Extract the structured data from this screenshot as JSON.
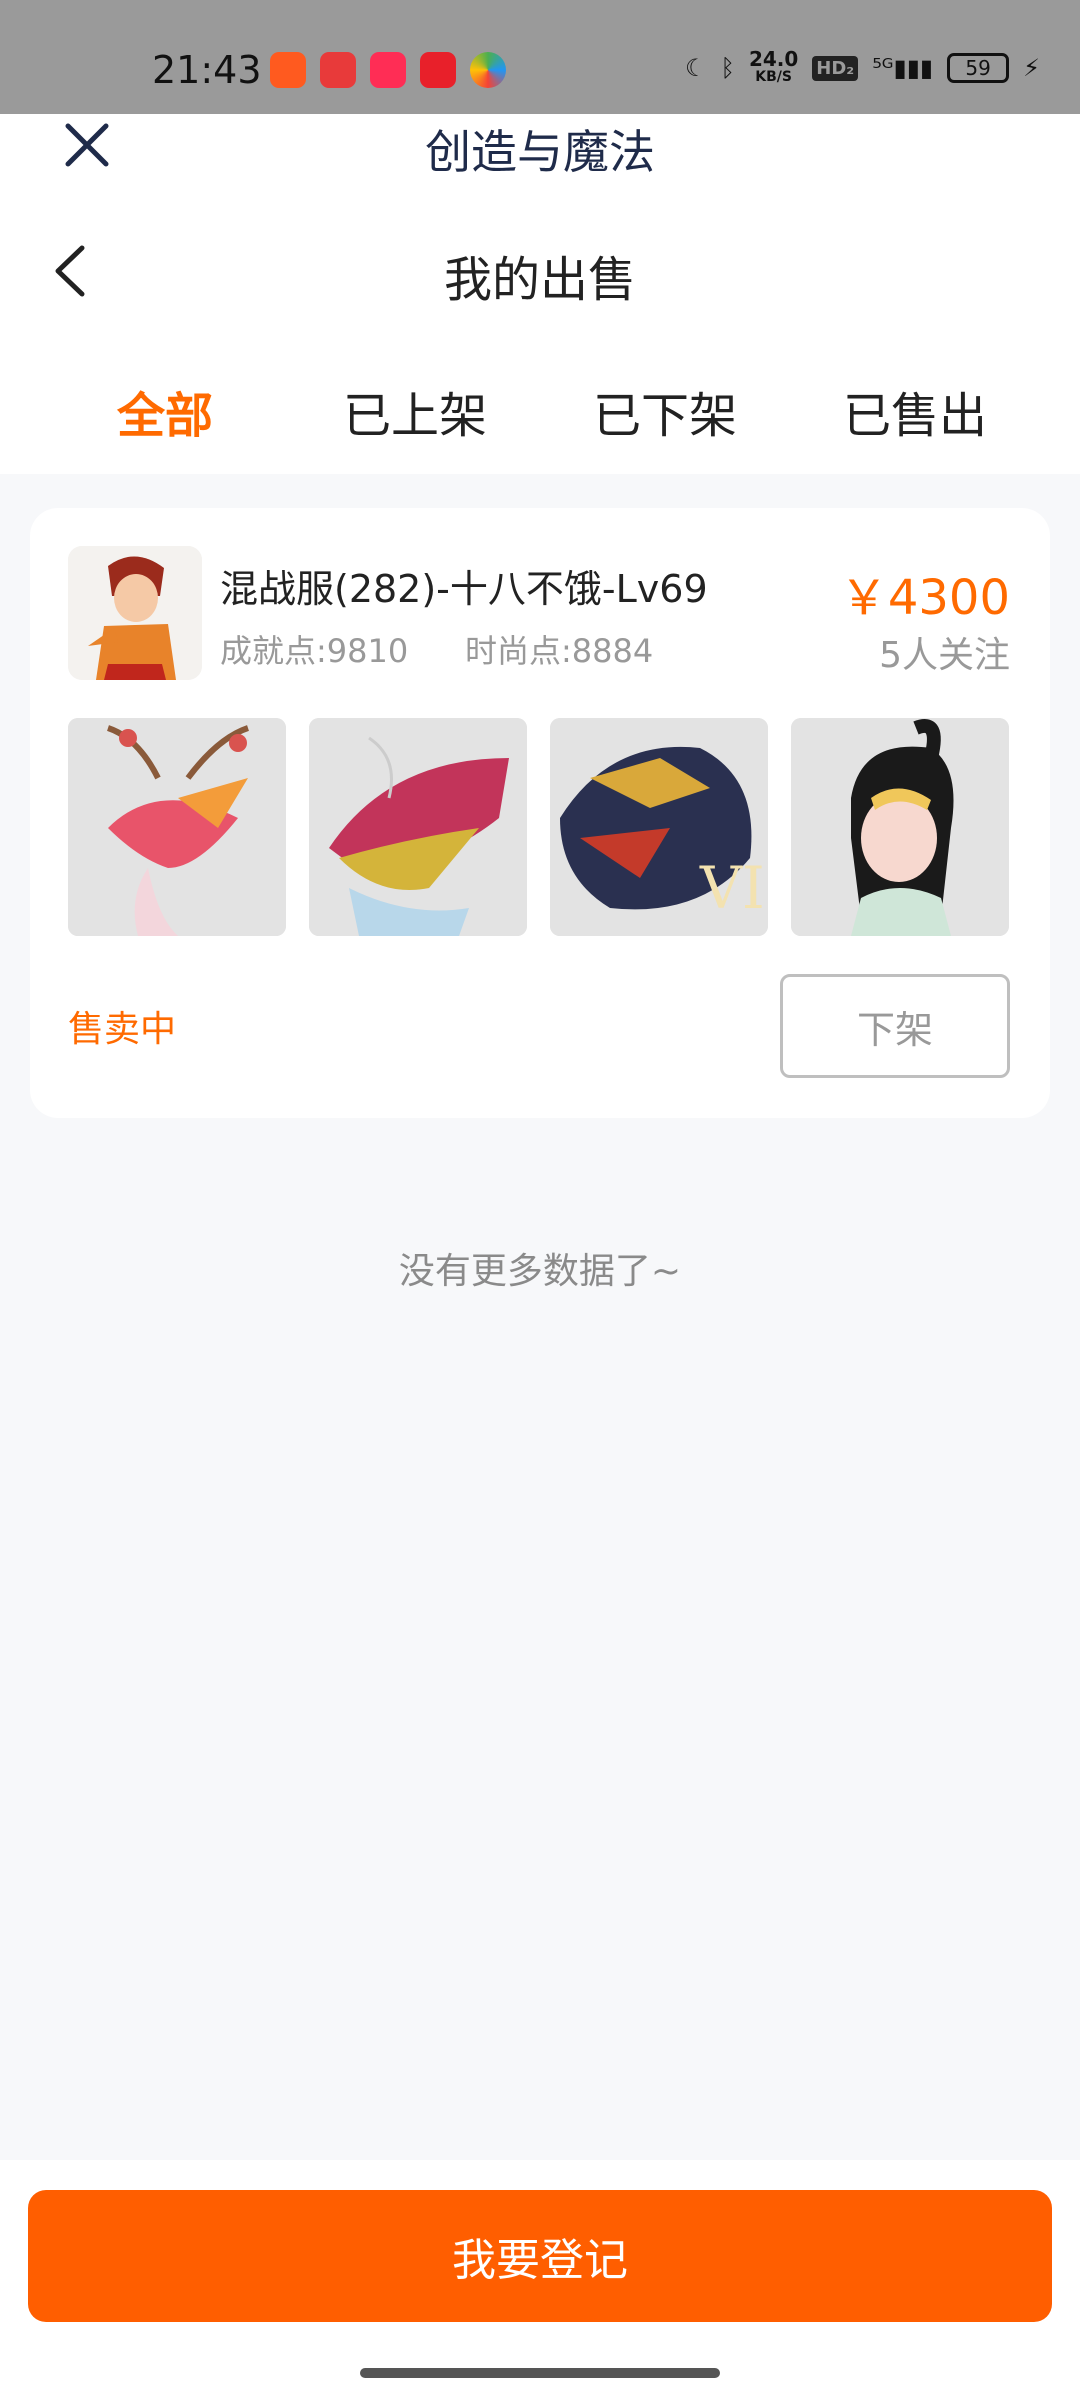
{
  "status_bar": {
    "time": "21:43",
    "net_speed": "24.0",
    "net_unit": "KB/S",
    "hd": "HD₂",
    "signal": "⁵ᴳ",
    "battery": "59"
  },
  "app_header": {
    "title": "创造与魔法"
  },
  "page": {
    "title": "我的出售"
  },
  "tabs": [
    {
      "label": "全部",
      "active": true
    },
    {
      "label": "已上架"
    },
    {
      "label": "已下架"
    },
    {
      "label": "已售出"
    }
  ],
  "listing": {
    "title": "混战服(282)-十八不饿-Lv69",
    "achievement": "成就点:9810",
    "fashion": "时尚点:8884",
    "price": "￥4300",
    "followers": "5人关注",
    "status": "售卖中",
    "action_label": "下架"
  },
  "footer_note": "没有更多数据了~",
  "register_button": "我要登记",
  "colors": {
    "accent": "#ff6a00",
    "button": "#ff5e00"
  }
}
